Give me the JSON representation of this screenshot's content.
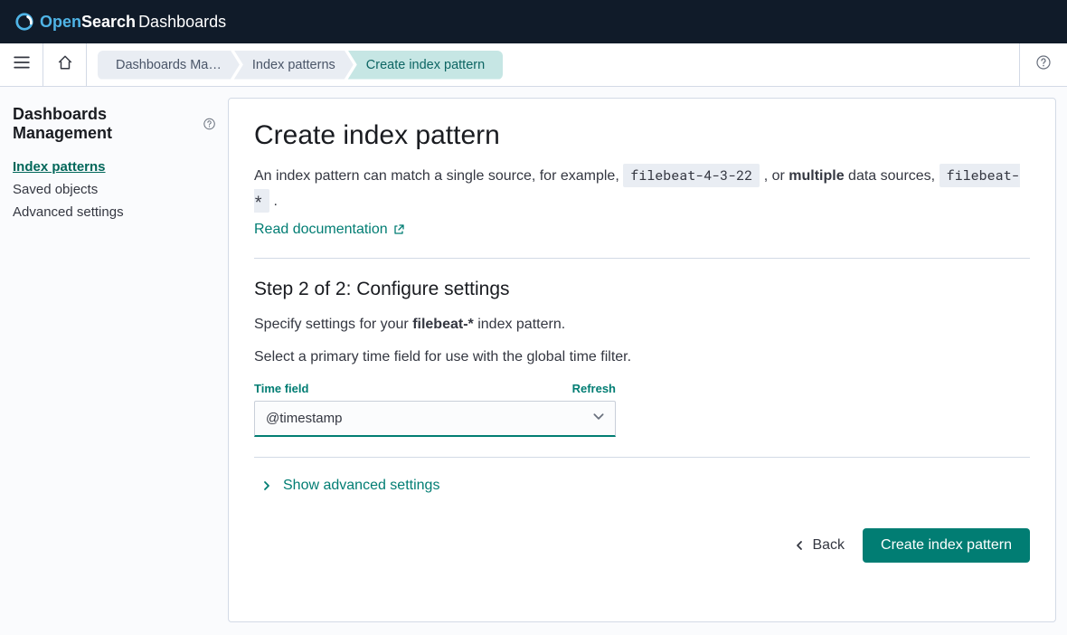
{
  "brand": {
    "open": "Open",
    "search": "Search",
    "dashboards": "Dashboards"
  },
  "breadcrumbs": [
    "Dashboards Ma…",
    "Index patterns",
    "Create index pattern"
  ],
  "sidebar": {
    "title": "Dashboards Management",
    "items": [
      {
        "label": "Index patterns",
        "active": true
      },
      {
        "label": "Saved objects",
        "active": false
      },
      {
        "label": "Advanced settings",
        "active": false
      }
    ]
  },
  "page": {
    "title": "Create index pattern",
    "desc_prefix": "An index pattern can match a single source, for example, ",
    "code1": "filebeat-4-3-22",
    "desc_mid": " , or ",
    "desc_bold": "multiple",
    "desc_suffix": " data sources, ",
    "code2": "filebeat-*",
    "desc_end": " .",
    "doc_link": "Read documentation",
    "step_title": "Step 2 of 2: Configure settings",
    "step_spec_prefix": "Specify settings for your ",
    "step_spec_bold": "filebeat-*",
    "step_spec_suffix": " index pattern.",
    "step_time_desc": "Select a primary time field for use with the global time filter.",
    "time_field_label": "Time field",
    "refresh_label": "Refresh",
    "time_field_value": "@timestamp",
    "advanced_toggle": "Show advanced settings",
    "back_label": "Back",
    "create_label": "Create index pattern"
  }
}
